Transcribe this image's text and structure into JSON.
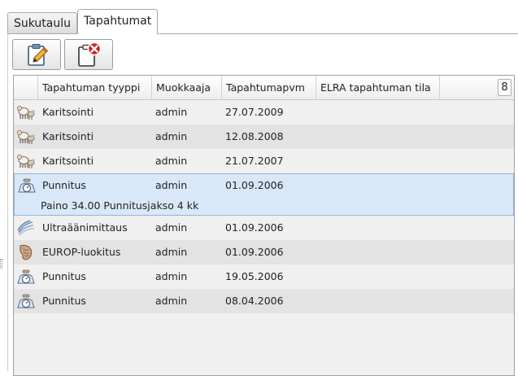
{
  "tabs": [
    {
      "label": "Sukutaulu",
      "active": false
    },
    {
      "label": "Tapahtumat",
      "active": true
    }
  ],
  "toolbar": {
    "edit_icon": "clipboard-edit-icon",
    "delete_icon": "clipboard-delete-icon"
  },
  "grid": {
    "columns": [
      "Tapahtuman tyyppi",
      "Muokkaaja",
      "Tapahtumapvm",
      "ELRA tapahtuman tila"
    ],
    "count": "8",
    "rows": [
      {
        "icon": "lamb-icon",
        "type": "Karitsointi",
        "editor": "admin",
        "date": "27.07.2009",
        "status": ""
      },
      {
        "icon": "lamb-icon",
        "type": "Karitsointi",
        "editor": "admin",
        "date": "12.08.2008",
        "status": ""
      },
      {
        "icon": "lamb-icon",
        "type": "Karitsointi",
        "editor": "admin",
        "date": "21.07.2007",
        "status": ""
      },
      {
        "icon": "scale-icon",
        "type": "Punnitus",
        "editor": "admin",
        "date": "01.09.2006",
        "status": "",
        "detail": "Paino 34.00 Punnitusjakso 4 kk"
      },
      {
        "icon": "ultrasound-icon",
        "type": "Ultraäänimittaus",
        "editor": "admin",
        "date": "01.09.2006",
        "status": ""
      },
      {
        "icon": "carcass-icon",
        "type": "EUROP-luokitus",
        "editor": "admin",
        "date": "01.09.2006",
        "status": ""
      },
      {
        "icon": "scale-icon",
        "type": "Punnitus",
        "editor": "admin",
        "date": "19.05.2006",
        "status": ""
      },
      {
        "icon": "scale-icon",
        "type": "Punnitus",
        "editor": "admin",
        "date": "08.04.2006",
        "status": ""
      }
    ]
  },
  "colors": {
    "selected_bg": "#d9e8f9",
    "selected_border": "#8eb4de",
    "alt_row": "#e3e3e3",
    "grid_bg": "#f0f0f0",
    "delete_red": "#d42020"
  }
}
